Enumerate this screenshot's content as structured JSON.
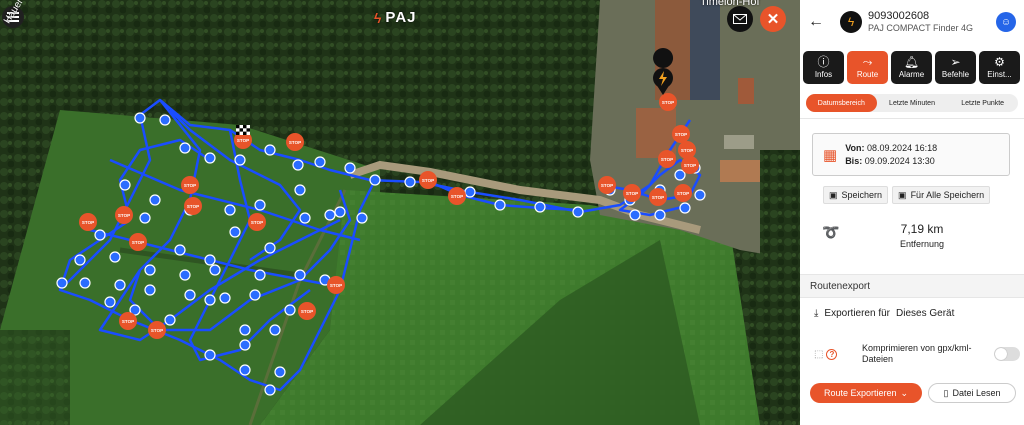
{
  "map": {
    "brand_logo": "PAJ",
    "place_label": "Timeloh-Hof",
    "street_label": "Hauer Straße",
    "menu_icon": "menu-icon",
    "mail_icon": "mail-icon",
    "close_icon": "close-icon",
    "stop_label": "STOP",
    "colors": {
      "route": "#1a4dff",
      "stop": "#e8542a",
      "point": "#2a6cff"
    }
  },
  "panel": {
    "device_id": "9093002608",
    "device_model": "PAJ COMPACT Finder 4G",
    "tabs": [
      {
        "label": "Infos",
        "icon": "info-icon",
        "active": false
      },
      {
        "label": "Route",
        "icon": "route-icon",
        "active": true
      },
      {
        "label": "Alarme",
        "icon": "bell-icon",
        "active": false
      },
      {
        "label": "Befehle",
        "icon": "send-icon",
        "active": false
      },
      {
        "label": "Einst...",
        "icon": "gear-icon",
        "active": false
      }
    ],
    "subtabs": [
      {
        "label": "Datumsbereich",
        "active": true
      },
      {
        "label": "Letzte Minuten",
        "active": false
      },
      {
        "label": "Letzte Punkte",
        "active": false
      }
    ],
    "date": {
      "from_label": "Von:",
      "from_value": "08.09.2024 16:18",
      "to_label": "Bis:",
      "to_value": "09.09.2024 13:30"
    },
    "save_label": "Speichern",
    "save_all_label": "Für Alle Speichern",
    "distance_value": "7,19 km",
    "distance_label": "Entfernung",
    "export_header": "Routenexport",
    "export_for_label": "Exportieren für",
    "export_target": "Dieses Gerät",
    "compress_label": "Komprimieren von gpx/kml-Dateien",
    "compress_enabled": false,
    "export_route_label": "Route Exportieren",
    "read_file_label": "Datei Lesen",
    "accent_color": "#e8542a"
  }
}
